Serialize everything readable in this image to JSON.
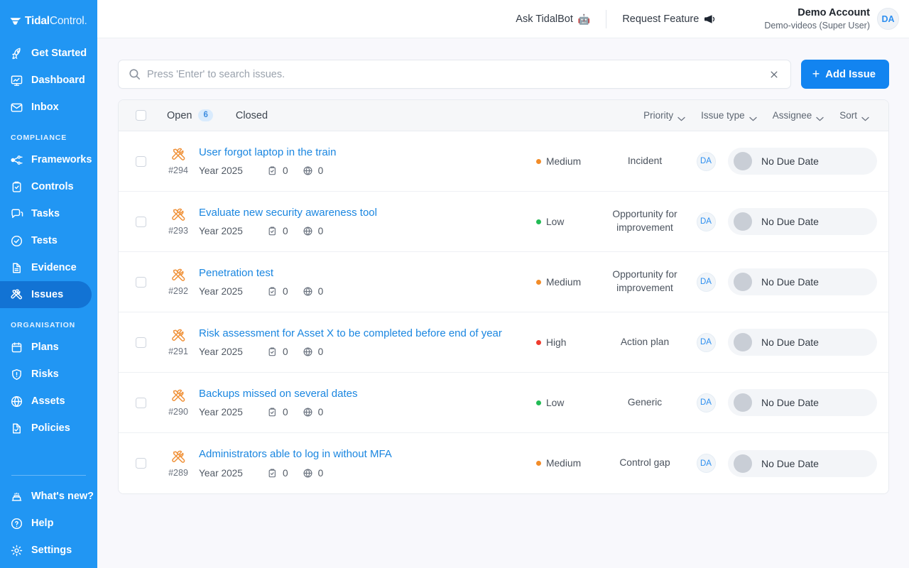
{
  "brand": {
    "name_bold": "Tidal",
    "name_light": "Control",
    "dot": ".",
    "sidebar_color": "#2196f3",
    "active_color": "#1273d4",
    "accent_color": "#1284f0"
  },
  "sidebar": {
    "primary": [
      {
        "label": "Get Started",
        "icon": "rocket-icon",
        "active": false
      },
      {
        "label": "Dashboard",
        "icon": "dashboard-icon",
        "active": false
      },
      {
        "label": "Inbox",
        "icon": "envelope-icon",
        "active": false
      }
    ],
    "section_compliance": "COMPLIANCE",
    "compliance": [
      {
        "label": "Frameworks",
        "icon": "frameworks-icon",
        "active": false
      },
      {
        "label": "Controls",
        "icon": "clipboard-check-icon",
        "active": false
      },
      {
        "label": "Tasks",
        "icon": "tasks-icon",
        "active": false
      },
      {
        "label": "Tests",
        "icon": "check-circle-icon",
        "active": false
      },
      {
        "label": "Evidence",
        "icon": "document-icon",
        "active": false
      },
      {
        "label": "Issues",
        "icon": "tools-icon",
        "active": true
      }
    ],
    "section_organisation": "ORGANISATION",
    "organisation": [
      {
        "label": "Plans",
        "icon": "calendar-icon",
        "active": false
      },
      {
        "label": "Risks",
        "icon": "shield-alert-icon",
        "active": false
      },
      {
        "label": "Assets",
        "icon": "globe-icon",
        "active": false
      },
      {
        "label": "Policies",
        "icon": "policy-doc-icon",
        "active": false
      }
    ],
    "bottom": [
      {
        "label": "What's new?",
        "icon": "cake-icon",
        "active": false
      },
      {
        "label": "Help",
        "icon": "question-circle-icon",
        "active": false
      },
      {
        "label": "Settings",
        "icon": "gear-icon",
        "active": false
      }
    ]
  },
  "topbar": {
    "ask_bot_label": "Ask TidalBot",
    "ask_bot_emoji": "🤖",
    "request_feature_label": "Request Feature",
    "account_name": "Demo Account",
    "account_sub": "Demo-videos (Super User)",
    "avatar_initials": "DA"
  },
  "search": {
    "placeholder": "Press 'Enter' to search issues.",
    "value": "",
    "clear_label": "✕"
  },
  "actions": {
    "add_issue_label": "Add Issue",
    "add_issue_plus": "+"
  },
  "table": {
    "tabs": [
      {
        "label": "Open",
        "count": "6",
        "active": true
      },
      {
        "label": "Closed",
        "count": "",
        "active": false
      }
    ],
    "filters": [
      {
        "label": "Priority"
      },
      {
        "label": "Issue type"
      },
      {
        "label": "Assignee"
      },
      {
        "label": "Sort"
      }
    ],
    "rows": [
      {
        "id": "#294",
        "title": "User forgot laptop in the train",
        "year": "Year 2025",
        "tasks_count": "0",
        "assets_count": "0",
        "priority": "Medium",
        "priority_color": "#f28c28",
        "type": "Incident",
        "assignee": "DA",
        "due": "No Due Date"
      },
      {
        "id": "#293",
        "title": "Evaluate new security awareness tool",
        "year": "Year 2025",
        "tasks_count": "0",
        "assets_count": "0",
        "priority": "Low",
        "priority_color": "#22bb55",
        "type": "Opportunity for improvement",
        "assignee": "DA",
        "due": "No Due Date"
      },
      {
        "id": "#292",
        "title": "Penetration test",
        "year": "Year 2025",
        "tasks_count": "0",
        "assets_count": "0",
        "priority": "Medium",
        "priority_color": "#f28c28",
        "type": "Opportunity for improvement",
        "assignee": "DA",
        "due": "No Due Date"
      },
      {
        "id": "#291",
        "title": "Risk assessment for Asset X to be completed before end of year",
        "year": "Year 2025",
        "tasks_count": "0",
        "assets_count": "0",
        "priority": "High",
        "priority_color": "#ef3b2d",
        "type": "Action plan",
        "assignee": "DA",
        "due": "No Due Date"
      },
      {
        "id": "#290",
        "title": "Backups missed on several dates",
        "year": "Year 2025",
        "tasks_count": "0",
        "assets_count": "0",
        "priority": "Low",
        "priority_color": "#22bb55",
        "type": "Generic",
        "assignee": "DA",
        "due": "No Due Date"
      },
      {
        "id": "#289",
        "title": "Administrators able to log in without MFA",
        "year": "Year 2025",
        "tasks_count": "0",
        "assets_count": "0",
        "priority": "Medium",
        "priority_color": "#f28c28",
        "type": "Control gap",
        "assignee": "DA",
        "due": "No Due Date"
      }
    ]
  }
}
